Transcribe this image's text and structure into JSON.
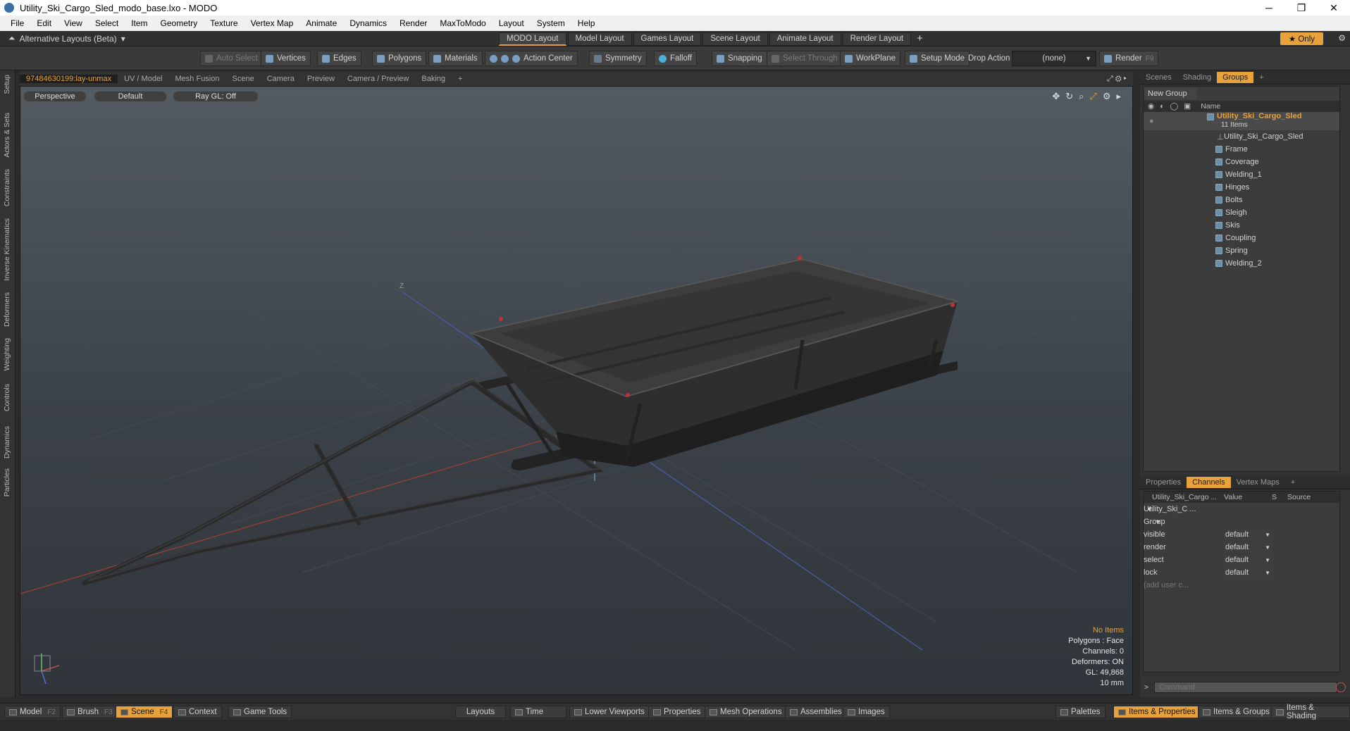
{
  "window": {
    "title": "Utility_Ski_Cargo_Sled_modo_base.lxo - MODO",
    "minimize": "─",
    "restore": "❐",
    "close": "✕"
  },
  "menu": [
    "File",
    "Edit",
    "View",
    "Select",
    "Item",
    "Geometry",
    "Texture",
    "Vertex Map",
    "Animate",
    "Dynamics",
    "Render",
    "MaxToModo",
    "Layout",
    "System",
    "Help"
  ],
  "layoutbar": {
    "alt_layouts": "Alternative Layouts (Beta)",
    "tabs": [
      "MODO Layout",
      "Model Layout",
      "Games Layout",
      "Scene Layout",
      "Animate Layout",
      "Render Layout"
    ],
    "active_tab": "MODO Layout",
    "plus": "+",
    "only": "★ Only"
  },
  "toolbar": {
    "auto_select": "Auto Select",
    "vertices": "Vertices",
    "edges": "Edges",
    "polygons": "Polygons",
    "materials": "Materials",
    "action_center": "Action Center",
    "symmetry": "Symmetry",
    "falloff": "Falloff",
    "snapping": "Snapping",
    "select_through": "Select Through",
    "workplane": "WorkPlane",
    "setup_mode": "Setup Mode",
    "drop_action": "Drop Action",
    "drop_value": "(none)",
    "render": "Render",
    "render_key": "F9"
  },
  "left_strip": [
    "Setup",
    "Actors & Sets",
    "Constraints",
    "Inverse Kinematics",
    "Deformers",
    "Weighting",
    "Controls",
    "Dynamics",
    "Particles"
  ],
  "viewport_tabs": [
    "97484630199:lay-unmax",
    "UV / Model",
    "Mesh Fusion",
    "Scene",
    "Camera",
    "Preview",
    "Camera / Preview",
    "Baking",
    "+"
  ],
  "viewport": {
    "view": "Perspective",
    "shading": "Default",
    "raygl": "Ray GL: Off",
    "info": {
      "items": "No Items",
      "polygons": "Polygons : Face",
      "channels": "Channels: 0",
      "deformers": "Deformers: ON",
      "gl": "GL: 49,868",
      "unit": "10 mm"
    },
    "axis_label": "Z"
  },
  "right_tabs": [
    "Scenes",
    "Shading",
    "Groups",
    "+"
  ],
  "groups": {
    "new_group": "New Group",
    "name_col": "Name",
    "root": "Utility_Ski_Cargo_Sled",
    "root_count": "11 Items",
    "items": [
      "Utility_Ski_Cargo_Sled",
      "Frame",
      "Coverage",
      "Welding_1",
      "Hinges",
      "Bolts",
      "Sleigh",
      "Skis",
      "Coupling",
      "Spring",
      "Welding_2"
    ]
  },
  "channels_tabs": [
    "Properties",
    "Channels",
    "Vertex Maps",
    "+"
  ],
  "channels": {
    "col_name": "Utility_Ski_Cargo ...",
    "col_value": "Value",
    "col_s": "S",
    "col_source": "Source",
    "item": "Utility_Ski_C ...",
    "group": "Group",
    "rows": [
      {
        "name": "visible",
        "value": "default"
      },
      {
        "name": "render",
        "value": "default"
      },
      {
        "name": "select",
        "value": "default"
      },
      {
        "name": "lock",
        "value": "default"
      }
    ],
    "add_user": "(add user c..."
  },
  "command": {
    "placeholder": "Command"
  },
  "bottom": {
    "model": "Model",
    "model_key": "F2",
    "brush": "Brush",
    "brush_key": "F3",
    "scene": "Scene",
    "scene_key": "F4",
    "context": "Context",
    "game_tools": "Game Tools",
    "layouts": "Layouts",
    "time": "Time",
    "lower_viewports": "Lower Viewports",
    "properties": "Properties",
    "mesh_operations": "Mesh Operations",
    "assemblies": "Assemblies",
    "images": "Images",
    "palettes": "Palettes",
    "items_properties": "Items & Properties",
    "items_groups": "Items & Groups",
    "items_shading": "Items & Shading"
  },
  "colors": {
    "accent": "#e8a23c",
    "viewport_top": "#525a62",
    "viewport_bottom": "#30353a"
  }
}
